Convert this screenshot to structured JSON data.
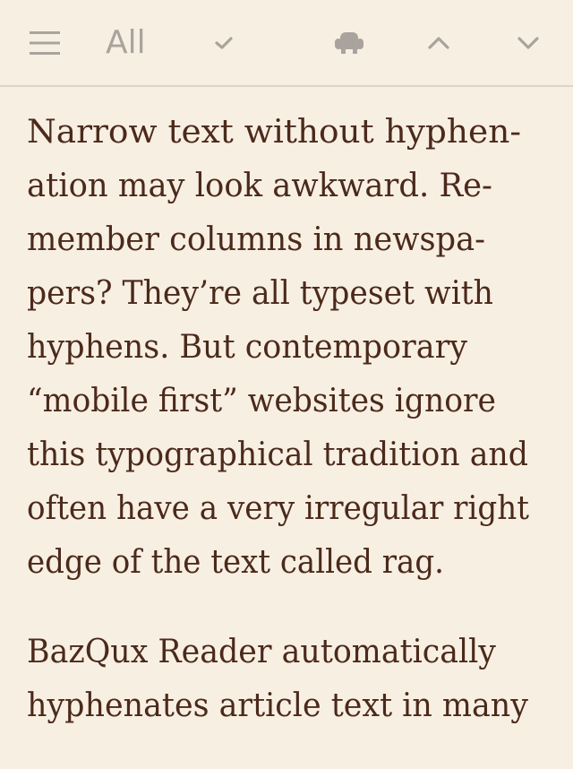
{
  "toolbar": {
    "filter_label": "All",
    "icons": [
      "menu-icon",
      "check-icon",
      "armchair-icon",
      "chevron-up-icon",
      "chevron-down-icon"
    ]
  },
  "article": {
    "paragraph1": [
      "Narrow text without hyphen-",
      "ation may look awkward. Re-",
      "member columns in newspa-",
      "pers? They’re all typeset with",
      "hyphens. But contemporary",
      "“mobile first” websites ignore",
      "this typographical tradition and",
      "often have a very irregular right",
      "edge of the text called rag."
    ],
    "paragraph2": [
      "BazQux Reader automatically",
      "hyphenates article text in many"
    ]
  },
  "colors": {
    "background": "#f8efe3",
    "text": "#4b2a1b",
    "toolbar_icon": "#a8a49d",
    "divider": "#ddd4c8"
  }
}
